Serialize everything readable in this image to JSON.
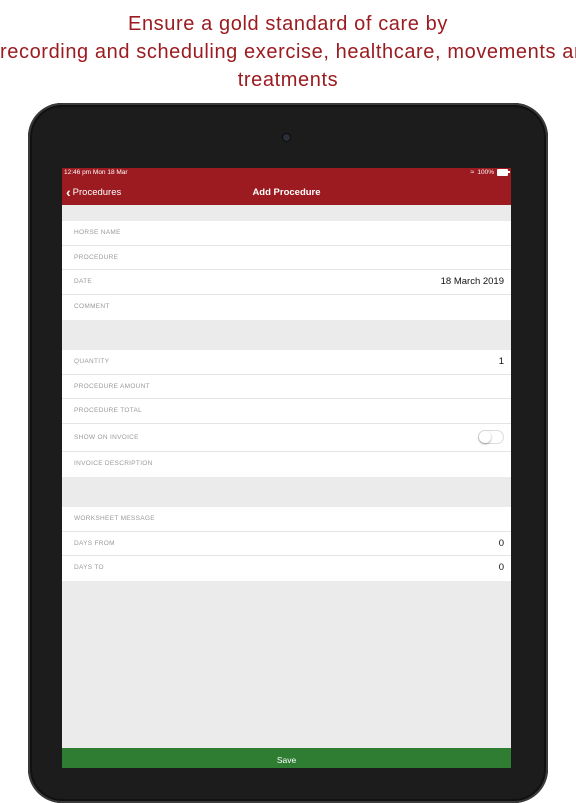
{
  "headline": {
    "line1": "Ensure a gold standard of care by",
    "line2": "recording and scheduling exercise, healthcare, movements and",
    "line3": "treatments"
  },
  "status_bar": {
    "time_date": "12:46 pm  Mon 18 Mar",
    "battery": "100%"
  },
  "nav": {
    "back_label": "Procedures",
    "title": "Add Procedure"
  },
  "section1": {
    "horse_name_label": "HORSE NAME",
    "procedure_label": "PROCEDURE",
    "date_label": "DATE",
    "date_value": "18 March 2019",
    "comment_label": "COMMENT"
  },
  "section2": {
    "quantity_label": "QUANTITY",
    "quantity_value": "1",
    "procedure_amount_label": "PROCEDURE AMOUNT",
    "procedure_total_label": "PROCEDURE TOTAL",
    "show_on_invoice_label": "SHOW ON INVOICE",
    "show_on_invoice_on": false,
    "invoice_description_label": "INVOICE DESCRIPTION"
  },
  "section3": {
    "worksheet_message_label": "WORKSHEET MESSAGE",
    "days_from_label": "DAYS FROM",
    "days_from_value": "0",
    "days_to_label": "DAYS TO",
    "days_to_value": "0"
  },
  "save_label": "Save",
  "colors": {
    "brand_red": "#9b1b20",
    "save_green": "#2e7d32",
    "background": "#ebebeb"
  }
}
